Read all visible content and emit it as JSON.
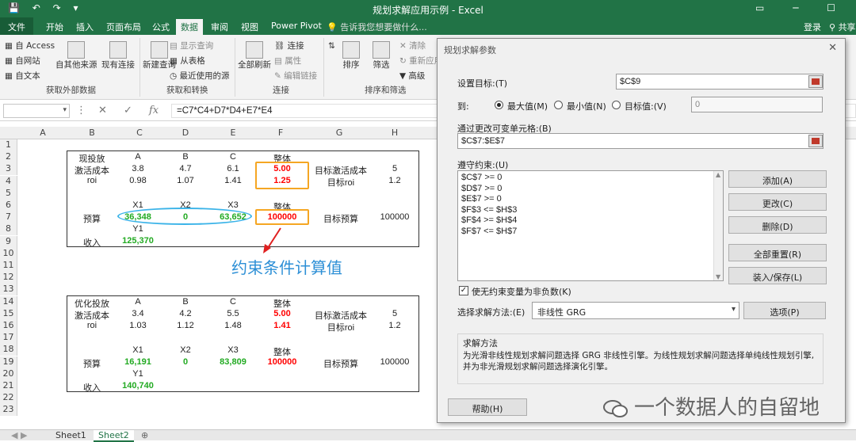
{
  "window": {
    "title": "规划求解应用示例 - Excel"
  },
  "ribbon_tabs": [
    "文件",
    "开始",
    "插入",
    "页面布局",
    "公式",
    "数据",
    "审阅",
    "视图",
    "Power Pivot"
  ],
  "tell_me": "告诉我您想要做什么...",
  "login": "登录",
  "share": "共享",
  "ribbon": {
    "get_external": {
      "access": "自 Access",
      "web": "自网站",
      "text": "自文本",
      "other": "自其他来源",
      "existing": "现有连接",
      "label": "获取外部数据"
    },
    "transform": {
      "new_query": "新建查询",
      "show_queries": "显示查询",
      "from_table": "从表格",
      "recent": "最近使用的源",
      "label": "获取和转换"
    },
    "connections": {
      "refresh": "全部刷新",
      "connections": "连接",
      "properties": "属性",
      "edit_links": "编辑链接",
      "label": "连接"
    },
    "sort_filter": {
      "sort": "排序",
      "filter": "筛选",
      "clear": "清除",
      "reapply": "重新应用",
      "advanced": "高级",
      "label": "排序和筛选"
    }
  },
  "formula_bar": {
    "formula": "=C7*C4+D7*D4+E7*E4"
  },
  "columns": [
    "A",
    "B",
    "C",
    "D",
    "E",
    "F",
    "G",
    "H"
  ],
  "rows": [
    "1",
    "2",
    "3",
    "4",
    "5",
    "6",
    "7",
    "8",
    "9",
    "10",
    "11",
    "12",
    "13",
    "14",
    "15",
    "16",
    "17",
    "18",
    "19",
    "20",
    "21",
    "22",
    "23"
  ],
  "sheet1": {
    "header": [
      "现投放",
      "A",
      "B",
      "C",
      "整体"
    ],
    "r3": [
      "激活成本",
      "3.8",
      "4.7",
      "6.1",
      "5.00",
      "目标激活成本",
      "5"
    ],
    "r4": [
      "roi",
      "0.98",
      "1.07",
      "1.41",
      "1.25",
      "目标roi",
      "1.2"
    ],
    "r6": [
      "X1",
      "X2",
      "X3",
      "整体"
    ],
    "r7": [
      "预算",
      "36,348",
      "0",
      "63,652",
      "100000",
      "目标预算",
      "100000"
    ],
    "r8": [
      "Y1"
    ],
    "r9": [
      "收入",
      "125,370"
    ]
  },
  "sheet2": {
    "header": [
      "优化投放",
      "A",
      "B",
      "C",
      "整体"
    ],
    "r15": [
      "激活成本",
      "3.4",
      "4.2",
      "5.5",
      "5.00",
      "目标激活成本",
      "5"
    ],
    "r16": [
      "roi",
      "1.03",
      "1.12",
      "1.48",
      "1.41",
      "目标roi",
      "1.2"
    ],
    "r18": [
      "X1",
      "X2",
      "X3",
      "整体"
    ],
    "r19": [
      "预算",
      "16,191",
      "0",
      "83,809",
      "100000",
      "目标预算",
      "100000"
    ],
    "r20": [
      "Y1"
    ],
    "r21": [
      "收入",
      "140,740"
    ]
  },
  "annotation": "约束条件计算值",
  "sheet_tabs": [
    "Sheet1",
    "Sheet2"
  ],
  "solver": {
    "title": "规划求解参数",
    "set_objective_label": "设置目标:(T)",
    "set_objective_value": "$C$9",
    "to_label": "到:",
    "max": "最大值(M)",
    "min": "最小值(N)",
    "value_of": "目标值:(V)",
    "value_of_value": "0",
    "changing_label": "通过更改可变单元格:(B)",
    "changing_value": "$C$7:$E$7",
    "constraints_label": "遵守约束:(U)",
    "constraints": [
      "$C$7 >= 0",
      "$D$7 >= 0",
      "$E$7 >= 0",
      "$F$3 <= $H$3",
      "$F$4 >= $H$4",
      "$F$7 <= $H$7"
    ],
    "btn_add": "添加(A)",
    "btn_change": "更改(C)",
    "btn_delete": "删除(D)",
    "btn_reset": "全部重置(R)",
    "btn_load": "装入/保存(L)",
    "nonneg": "使无约束变量为非负数(K)",
    "method_label": "选择求解方法:(E)",
    "method_value": "非线性 GRG",
    "btn_options": "选项(P)",
    "method_title": "求解方法",
    "method_desc": "为光滑非线性规划求解问题选择 GRG 非线性引擎。为线性规划求解问题选择单纯线性规划引擎,并为非光滑规划求解问题选择演化引擎。",
    "btn_help": "帮助(H)"
  },
  "watermark": "一个数据人的自留地"
}
